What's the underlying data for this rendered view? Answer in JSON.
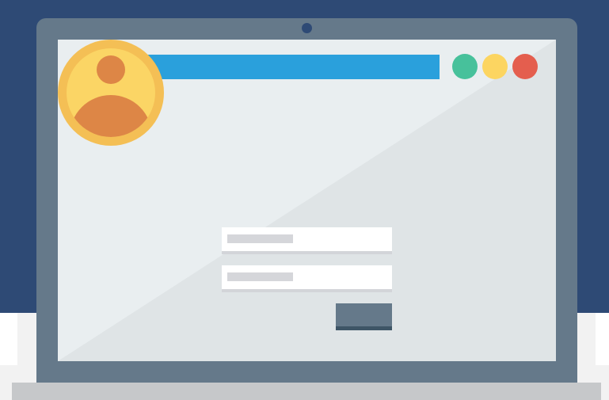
{
  "colors": {
    "background_navy": "#2e4a75",
    "laptop_frame": "#65798a",
    "laptop_base": "#c6c8ca",
    "camera": "#2e4a75",
    "screen_light": "#e9eef0",
    "screen_shade": "#dfe4e6",
    "address_bar": "#2aa0dc",
    "btn_green": "#47c19b",
    "btn_yellow": "#fcd561",
    "btn_red": "#e45e4e",
    "avatar_ring": "#f4bf55",
    "avatar_fill": "#fbd565",
    "avatar_person": "#dd8646",
    "login_button": "#65798a"
  },
  "icons": {
    "avatar": "user-avatar-icon",
    "camera": "webcam-icon"
  },
  "window_controls": [
    "minimize",
    "maximize",
    "close"
  ],
  "form": {
    "field_count": 2
  }
}
